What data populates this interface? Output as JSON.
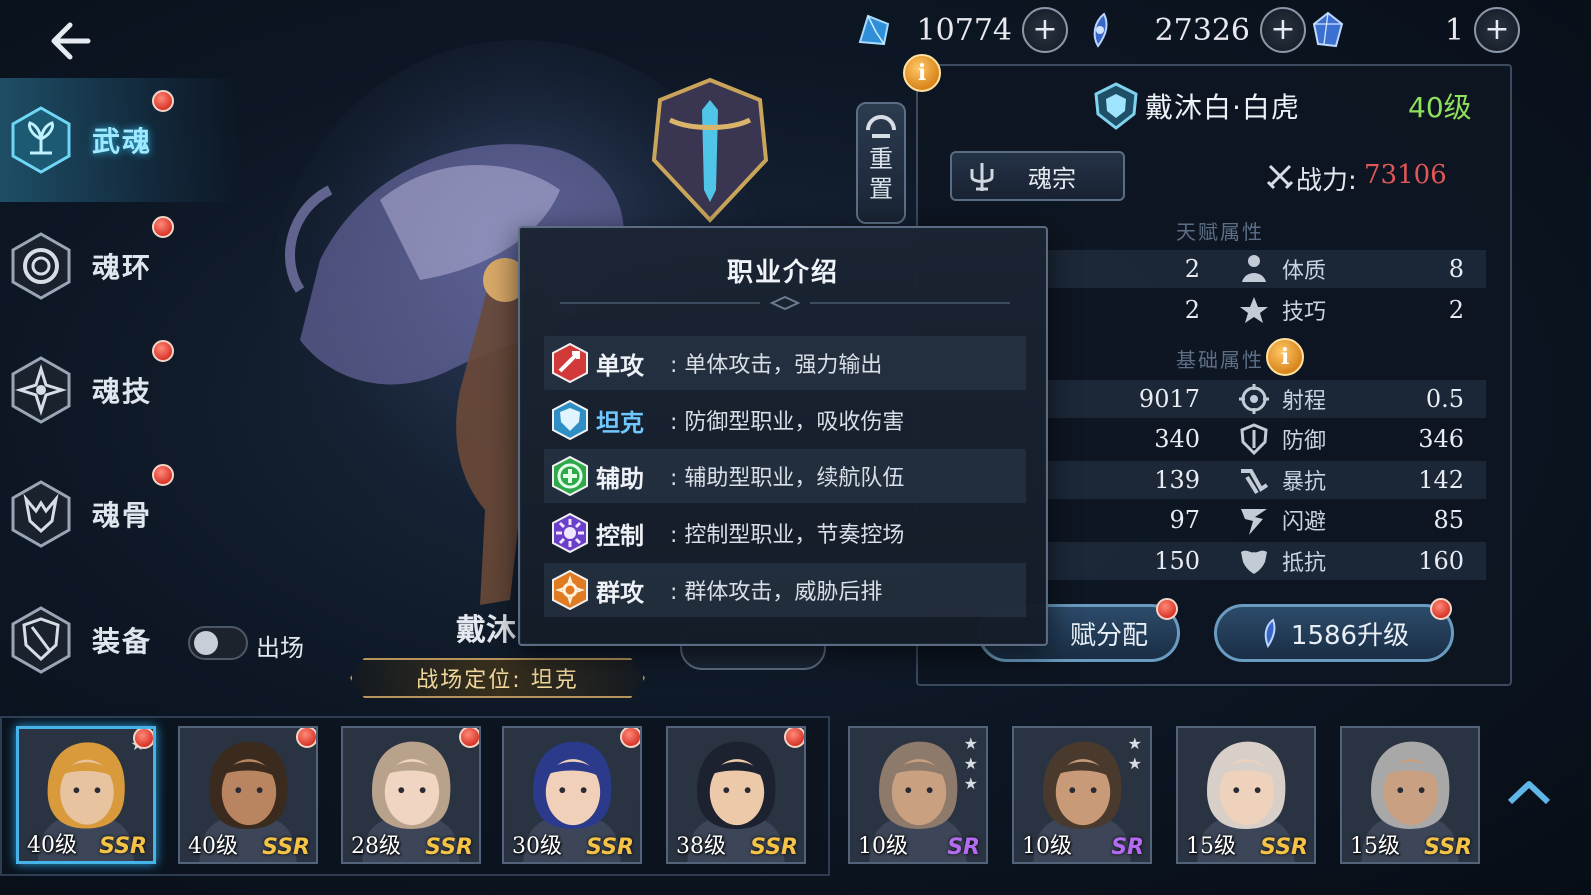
{
  "topbar": {
    "currencies": [
      {
        "icon": "blue-crystal-icon",
        "value": "10774"
      },
      {
        "icon": "soul-feather-icon",
        "value": "27326"
      },
      {
        "icon": "blue-gem-icon",
        "value": "1"
      }
    ],
    "plus": "+"
  },
  "menu": {
    "items": [
      {
        "label": "武魂",
        "active": true
      },
      {
        "label": "魂环",
        "active": false
      },
      {
        "label": "魂技",
        "active": false
      },
      {
        "label": "魂骨",
        "active": false
      },
      {
        "label": "装备",
        "active": false
      }
    ],
    "deploy_label": "出场"
  },
  "reset_button": {
    "line1": "重",
    "line2": "置"
  },
  "hero": {
    "name": "戴沐白·白虎",
    "level": "40级",
    "class_label": "魂宗",
    "power_label": "战力:",
    "power_value": "73106",
    "name_bottom": "戴沐",
    "battle_role": "战场定位: 坦克",
    "info_mark": "i"
  },
  "stats": {
    "talent_title": "天赋属性",
    "talent_rows": [
      {
        "left_value": "2",
        "right_name": "体质",
        "right_value": "8",
        "icon": "physique-icon"
      },
      {
        "left_value": "2",
        "right_name": "技巧",
        "right_value": "2",
        "icon": "skill-icon"
      }
    ],
    "base_title": "基础属性",
    "base_rows": [
      {
        "left_value": "9017",
        "right_name": "射程",
        "right_value": "0.5",
        "icon": "range-icon"
      },
      {
        "left_value": "340",
        "right_name": "防御",
        "right_value": "346",
        "icon": "defense-icon"
      },
      {
        "left_value": "139",
        "right_name": "暴抗",
        "right_value": "142",
        "icon": "crit-resist-icon"
      },
      {
        "left_value": "97",
        "right_name": "闪避",
        "right_value": "85",
        "icon": "dodge-icon"
      },
      {
        "left_value": "150",
        "right_name": "抵抗",
        "right_value": "160",
        "icon": "resist-icon"
      }
    ]
  },
  "actions": {
    "talent_btn": "赋分配",
    "upgrade_btn": "1586升级"
  },
  "popup": {
    "title": "职业介绍",
    "roles": [
      {
        "name": "单攻",
        "desc": ": 单体攻击，强力输出",
        "color": "#d23a3a",
        "icon": "single-attack-icon",
        "name_color": "#eef1f5"
      },
      {
        "name": "坦克",
        "desc": ": 防御型职业，吸收伤害",
        "color": "#2f8fc4",
        "icon": "tank-shield-icon",
        "name_color": "#6fc8ff"
      },
      {
        "name": "辅助",
        "desc": ": 辅助型职业，续航队伍",
        "color": "#2fa84a",
        "icon": "support-cross-icon",
        "name_color": "#eef1f5"
      },
      {
        "name": "控制",
        "desc": ": 控制型职业，节奏控场",
        "color": "#6c3fc9",
        "icon": "control-icon",
        "name_color": "#eef1f5"
      },
      {
        "name": "群攻",
        "desc": ": 群体攻击，威胁后排",
        "color": "#e07b24",
        "icon": "aoe-attack-icon",
        "name_color": "#eef1f5"
      }
    ]
  },
  "roster": [
    {
      "level": "40级",
      "rarity": "SSR",
      "selected": true,
      "dot": true,
      "stars": 1,
      "hair": "#d89a3a",
      "skin": "#e8c39f"
    },
    {
      "level": "40级",
      "rarity": "SSR",
      "selected": false,
      "dot": true,
      "stars": 0,
      "hair": "#3b2a1e",
      "skin": "#b98561"
    },
    {
      "level": "28级",
      "rarity": "SSR",
      "selected": false,
      "dot": true,
      "stars": 0,
      "hair": "#b8a28c",
      "skin": "#efd5c2"
    },
    {
      "level": "30级",
      "rarity": "SSR",
      "selected": false,
      "dot": true,
      "stars": 0,
      "hair": "#2b3a8a",
      "skin": "#f0d0b8"
    },
    {
      "level": "38级",
      "rarity": "SSR",
      "selected": false,
      "dot": true,
      "stars": 0,
      "hair": "#1c2230",
      "skin": "#eccaa9"
    },
    {
      "level": "10级",
      "rarity": "SR",
      "selected": false,
      "dot": false,
      "stars": 3,
      "hair": "#8d7a6a",
      "skin": "#c9a181"
    },
    {
      "level": "10级",
      "rarity": "SR",
      "selected": false,
      "dot": false,
      "stars": 2,
      "hair": "#4a3a2e",
      "skin": "#c89a78"
    },
    {
      "level": "15级",
      "rarity": "SSR",
      "selected": false,
      "dot": false,
      "stars": 0,
      "hair": "#d8d0c8",
      "skin": "#eed2bc"
    },
    {
      "level": "15级",
      "rarity": "SSR",
      "selected": false,
      "dot": false,
      "stars": 0,
      "hair": "#a8a8a8",
      "skin": "#c9a182"
    }
  ]
}
